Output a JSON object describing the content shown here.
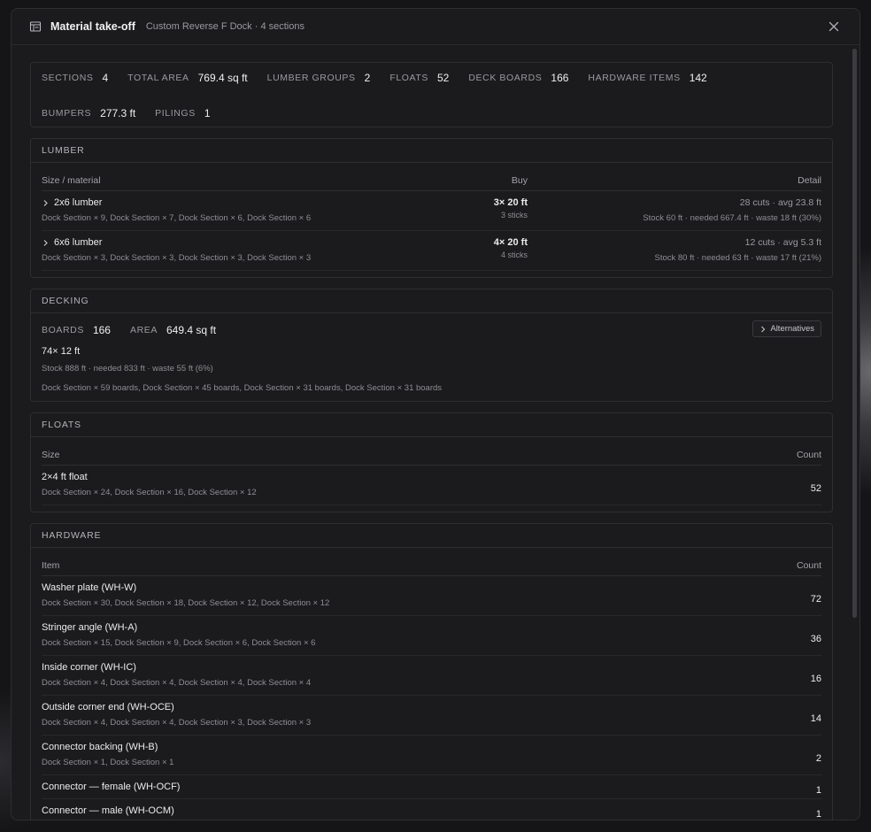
{
  "header": {
    "title": "Material take-off",
    "subtitle": "Custom Reverse F Dock · 4 sections"
  },
  "summary": {
    "stats": [
      {
        "label": "SECTIONS",
        "value": "4"
      },
      {
        "label": "TOTAL AREA",
        "value": "769.4 sq ft"
      },
      {
        "label": "LUMBER GROUPS",
        "value": "2"
      },
      {
        "label": "FLOATS",
        "value": "52"
      },
      {
        "label": "DECK BOARDS",
        "value": "166"
      },
      {
        "label": "HARDWARE ITEMS",
        "value": "142"
      }
    ],
    "stats2": [
      {
        "label": "BUMPERS",
        "value": "277.3 ft"
      },
      {
        "label": "PILINGS",
        "value": "1"
      }
    ]
  },
  "lumber": {
    "title": "LUMBER",
    "columns": {
      "name": "Size / material",
      "buy": "Buy",
      "detail": "Detail"
    },
    "rows": [
      {
        "name": "2x6 lumber",
        "sections": "Dock Section × 9, Dock Section × 7, Dock Section × 6, Dock Section × 6",
        "buy": "3× 20 ft",
        "sticks": "3 sticks",
        "cuts": "28 cuts · avg 23.8 ft",
        "stock": "Stock 60 ft · needed 667.4 ft · waste 18 ft (30%)"
      },
      {
        "name": "6x6 lumber",
        "sections": "Dock Section × 3, Dock Section × 3, Dock Section × 3, Dock Section × 3",
        "buy": "4× 20 ft",
        "sticks": "4 sticks",
        "cuts": "12 cuts · avg 5.3 ft",
        "stock": "Stock 80 ft · needed 63 ft · waste 17 ft (21%)"
      }
    ]
  },
  "decking": {
    "title": "DECKING",
    "boards_label": "BOARDS",
    "boards_value": "166",
    "area_label": "AREA",
    "area_value": "649.4 sq ft",
    "alternatives_label": "Alternatives",
    "line": "74× 12 ft",
    "stock": "Stock 888 ft · needed 833 ft · waste 55 ft (6%)",
    "sections": "Dock Section × 59 boards, Dock Section × 45 boards, Dock Section × 31 boards, Dock Section × 31 boards"
  },
  "floats": {
    "title": "FLOATS",
    "columns": {
      "name": "Size",
      "count": "Count"
    },
    "rows": [
      {
        "name": "2×4 ft float",
        "sections": "Dock Section × 24, Dock Section × 16, Dock Section × 12",
        "count": "52"
      }
    ]
  },
  "hardware": {
    "title": "HARDWARE",
    "columns": {
      "name": "Item",
      "count": "Count"
    },
    "rows": [
      {
        "name": "Washer plate (WH-W)",
        "sections": "Dock Section × 30, Dock Section × 18, Dock Section × 12, Dock Section × 12",
        "count": "72"
      },
      {
        "name": "Stringer angle (WH-A)",
        "sections": "Dock Section × 15, Dock Section × 9, Dock Section × 6, Dock Section × 6",
        "count": "36"
      },
      {
        "name": "Inside corner (WH-IC)",
        "sections": "Dock Section × 4, Dock Section × 4, Dock Section × 4, Dock Section × 4",
        "count": "16"
      },
      {
        "name": "Outside corner end (WH-OCE)",
        "sections": "Dock Section × 4, Dock Section × 4, Dock Section × 3, Dock Section × 3",
        "count": "14"
      },
      {
        "name": "Connector backing (WH-B)",
        "sections": "Dock Section × 1, Dock Section × 1",
        "count": "2"
      },
      {
        "name": "Connector — female (WH-OCF)",
        "sections": "",
        "count": "1"
      },
      {
        "name": "Connector — male (WH-OCM)",
        "sections": "",
        "count": "1"
      }
    ]
  },
  "colors": {
    "background": "#1b1b1d",
    "border": "#2e2e31",
    "text": "#ececef",
    "muted": "#8e8e94"
  },
  "icons": {
    "header": "table-icon",
    "close": "close-icon",
    "expand": "chevron-right-icon"
  }
}
